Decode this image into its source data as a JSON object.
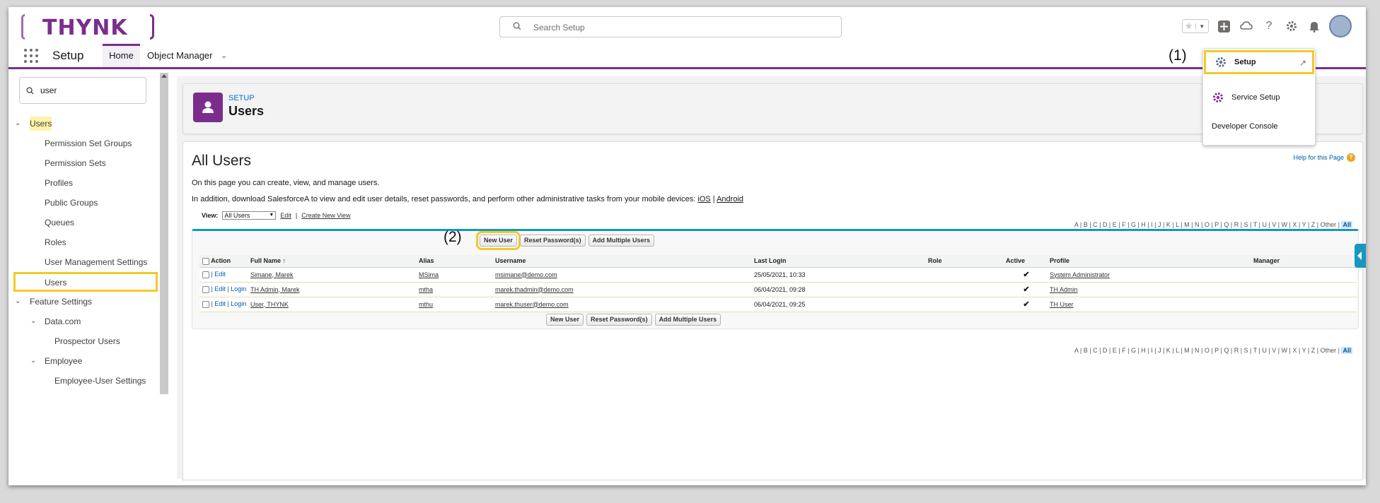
{
  "app": {
    "logo": "THYNK",
    "search_placeholder": "Search Setup",
    "app_name": "Setup",
    "tabs": {
      "home": "Home",
      "object_manager": "Object Manager"
    }
  },
  "header_icons": [
    "star-icon",
    "add-icon",
    "trailhead-icon",
    "help-icon",
    "gear-icon",
    "bell-icon",
    "avatar"
  ],
  "setup_menu": {
    "items": [
      "Setup",
      "Service Setup",
      "Developer Console"
    ],
    "annotation": "(1)"
  },
  "sidebar": {
    "search_value": "user",
    "users_group": "Users",
    "items": [
      "Permission Set Groups",
      "Permission Sets",
      "Profiles",
      "Public Groups",
      "Queues",
      "Roles",
      "User Management Settings",
      "Users"
    ],
    "feature_settings": "Feature Settings",
    "datacom": "Data.com",
    "prospector": "Prospector Users",
    "employee": "Employee",
    "employee_settings": "Employee-User Settings"
  },
  "page": {
    "eyebrow": "SETUP",
    "title": "Users",
    "heading": "All Users",
    "help": "Help for this Page",
    "intro1": "On this page you can create, view, and manage users.",
    "intro2": "In addition, download SalesforceA to view and edit user details, reset passwords, and perform other administrative tasks from your mobile devices:",
    "ios": "iOS",
    "sep": "|",
    "android": "Android",
    "view_label": "View:",
    "view_value": "All Users",
    "edit_link": "Edit",
    "create_view": "Create New View",
    "alpha": "A | B | C | D | E | F | G | H | I | J | K | L | M | N | O | P | Q | R | S | T | U | V | W | X | Y | Z | Other",
    "alpha_all": "All",
    "annotation": "(2)"
  },
  "buttons": {
    "new_user": "New User",
    "reset": "Reset Password(s)",
    "add_multiple": "Add Multiple Users"
  },
  "table": {
    "headers": [
      "Action",
      "Full Name",
      "Alias",
      "Username",
      "Last Login",
      "Role",
      "Active",
      "Profile",
      "Manager"
    ],
    "sort_arrow": "↑",
    "rows": [
      {
        "action": "| Edit",
        "login": "",
        "name": "Simane, Marek",
        "alias": "MSima",
        "username": "msimane@demo.com",
        "last_login": "25/05/2021, 10:33",
        "role": "",
        "active": "✔",
        "profile": "System Administrator",
        "manager": ""
      },
      {
        "action": "| Edit | ",
        "login": "Login",
        "name": "TH Admin, Marek",
        "alias": "mtha",
        "username": "marek.thadmin@demo.com",
        "last_login": "06/04/2021, 09:28",
        "role": "",
        "active": "✔",
        "profile": "TH Admin",
        "manager": ""
      },
      {
        "action": "| Edit | ",
        "login": "Login",
        "name": "User, THYNK",
        "alias": "mthu",
        "username": "marek.thuser@demo.com",
        "last_login": "06/04/2021, 09:25",
        "role": "",
        "active": "✔",
        "profile": "TH User",
        "manager": ""
      }
    ]
  },
  "colors": {
    "brand": "#7b2d8e",
    "highlight": "#f4c927",
    "link": "#015ba7",
    "accent": "#1797c0"
  }
}
